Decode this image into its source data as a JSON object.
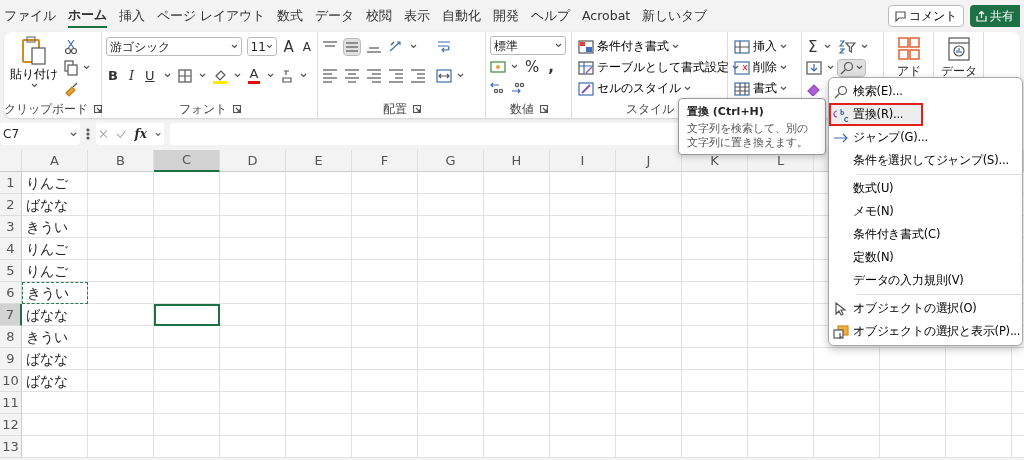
{
  "menu_tabs": [
    {
      "label": "ファイル",
      "selected": false
    },
    {
      "label": "ホーム",
      "selected": true
    },
    {
      "label": "挿入",
      "selected": false
    },
    {
      "label": "ページ レイアウト",
      "selected": false
    },
    {
      "label": "数式",
      "selected": false
    },
    {
      "label": "データ",
      "selected": false
    },
    {
      "label": "校閲",
      "selected": false
    },
    {
      "label": "表示",
      "selected": false
    },
    {
      "label": "自動化",
      "selected": false
    },
    {
      "label": "開発",
      "selected": false
    },
    {
      "label": "ヘルプ",
      "selected": false
    },
    {
      "label": "Acrobat",
      "selected": false
    },
    {
      "label": "新しいタブ",
      "selected": false
    }
  ],
  "top_buttons": {
    "comment": "コメント",
    "share": "共有"
  },
  "ribbon": {
    "clipboard": {
      "paste": "貼り付け",
      "label": "クリップボード"
    },
    "font": {
      "font_name": "游ゴシック",
      "font_size": "11",
      "grow": "A",
      "shrink": "A",
      "bold": "B",
      "italic": "I",
      "underline": "U",
      "color_letter": "A",
      "label": "フォント"
    },
    "alignment": {
      "middle_pressed": true,
      "label": "配置"
    },
    "number": {
      "format": "標準",
      "percent": "%",
      "comma": ",",
      "label": "数値"
    },
    "styles": {
      "items": [
        "条件付き書式",
        "テーブルとして書式設定",
        "セルのスタイル"
      ],
      "label": "スタイル"
    },
    "cells": {
      "items": [
        "挿入",
        "削除",
        "書式"
      ]
    },
    "editing": {
      "sum": "Σ",
      "find_pressed": true
    },
    "addins": {
      "label": "アド"
    },
    "analysis": {
      "label": "データ"
    }
  },
  "formula_bar": {
    "name_box": "C7",
    "fx": "fx"
  },
  "sheet": {
    "columns": [
      {
        "label": "A",
        "selected": false
      },
      {
        "label": "B",
        "selected": false
      },
      {
        "label": "C",
        "selected": true
      },
      {
        "label": "D",
        "selected": false
      },
      {
        "label": "E",
        "selected": false
      },
      {
        "label": "F",
        "selected": false
      },
      {
        "label": "G",
        "selected": false
      },
      {
        "label": "H",
        "selected": false
      },
      {
        "label": "I",
        "selected": false
      },
      {
        "label": "J",
        "selected": false
      },
      {
        "label": "K",
        "selected": false
      },
      {
        "label": "L",
        "selected": false
      }
    ],
    "rows": [
      {
        "label": "1",
        "selected": false,
        "copied": false,
        "cells": [
          "りんご"
        ]
      },
      {
        "label": "2",
        "selected": false,
        "copied": false,
        "cells": [
          "ばなな"
        ]
      },
      {
        "label": "3",
        "selected": false,
        "copied": false,
        "cells": [
          "きうい"
        ]
      },
      {
        "label": "4",
        "selected": false,
        "copied": false,
        "cells": [
          "りんご"
        ]
      },
      {
        "label": "5",
        "selected": false,
        "copied": false,
        "cells": [
          "りんご"
        ]
      },
      {
        "label": "6",
        "selected": false,
        "copied": true,
        "cells": [
          "きうい"
        ]
      },
      {
        "label": "7",
        "selected": true,
        "copied": false,
        "cells": [
          "ばなな"
        ]
      },
      {
        "label": "8",
        "selected": false,
        "copied": false,
        "cells": [
          "きうい"
        ]
      },
      {
        "label": "9",
        "selected": false,
        "copied": false,
        "cells": [
          "ばなな"
        ]
      },
      {
        "label": "10",
        "selected": false,
        "copied": false,
        "cells": [
          "ばなな"
        ]
      },
      {
        "label": "11",
        "selected": false,
        "copied": false
      },
      {
        "label": "12",
        "selected": false,
        "copied": false
      },
      {
        "label": "13",
        "selected": false,
        "copied": false
      }
    ]
  },
  "tooltip": {
    "title": "置換 (Ctrl+H)",
    "text": "文字列を検索して、別の文字列に置き換えます。"
  },
  "dropdown": {
    "sections": [
      [
        {
          "label": "検索(E)...",
          "kind": "find",
          "highlighted": false
        },
        {
          "label": "置換(R)...",
          "kind": "replace",
          "highlighted": true
        },
        {
          "label": "ジャンプ(G)...",
          "kind": "goto",
          "highlighted": false
        },
        {
          "label": "条件を選択してジャンプ(S)...",
          "kind": "plain",
          "highlighted": false
        }
      ],
      [
        {
          "label": "数式(U)",
          "kind": "plain",
          "highlighted": false
        },
        {
          "label": "メモ(N)",
          "kind": "plain",
          "highlighted": false
        },
        {
          "label": "条件付き書式(C)",
          "kind": "plain",
          "highlighted": false
        },
        {
          "label": "定数(N)",
          "kind": "plain",
          "highlighted": false
        },
        {
          "label": "データの入力規則(V)",
          "kind": "plain",
          "highlighted": false
        }
      ],
      [
        {
          "label": "オブジェクトの選択(O)",
          "kind": "pointer",
          "highlighted": false
        },
        {
          "label": "オブジェクトの選択と表示(P)...",
          "kind": "pane",
          "highlighted": false
        }
      ]
    ]
  }
}
